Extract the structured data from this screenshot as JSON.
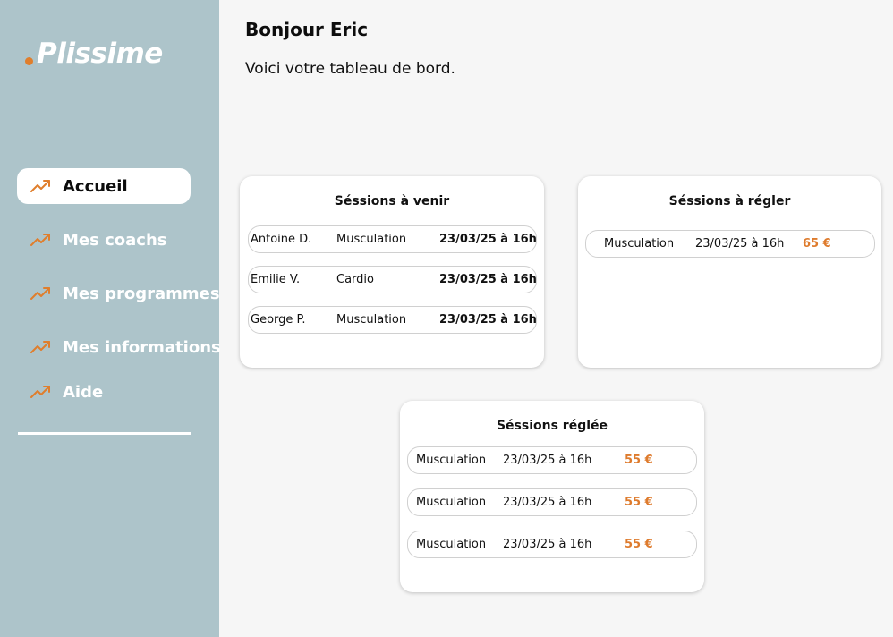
{
  "brand": {
    "name": "Plissime",
    "accent_color": "#e07e2c",
    "sidebar_color": "#adc4ca"
  },
  "sidebar": {
    "items": [
      {
        "label": "Accueil",
        "icon": "trending-up-icon",
        "active": true
      },
      {
        "label": "Mes coachs",
        "icon": "trending-up-icon",
        "active": false
      },
      {
        "label": "Mes programmes",
        "icon": "trending-up-icon",
        "active": false
      },
      {
        "label": "Mes informations",
        "icon": "trending-up-icon",
        "active": false
      },
      {
        "label": "Aide",
        "icon": "trending-up-icon",
        "active": false
      }
    ]
  },
  "header": {
    "greeting": "Bonjour Eric",
    "subtitle": "Voici votre tableau de bord."
  },
  "upcoming": {
    "title": "Séssions à venir",
    "rows": [
      {
        "coach": "Antoine D.",
        "activity": "Musculation",
        "date": "23/03/25 à 16h"
      },
      {
        "coach": "Emilie V.",
        "activity": "Cardio",
        "date": "23/03/25 à 16h"
      },
      {
        "coach": "George P.",
        "activity": "Musculation",
        "date": "23/03/25 à 16h"
      }
    ]
  },
  "to_pay": {
    "title": "Séssions à régler",
    "rows": [
      {
        "activity": "Musculation",
        "date": "23/03/25 à 16h",
        "price": "65 €"
      }
    ]
  },
  "paid": {
    "title": "Séssions réglée",
    "rows": [
      {
        "activity": "Musculation",
        "date": "23/03/25 à 16h",
        "price": "55 €"
      },
      {
        "activity": "Musculation",
        "date": "23/03/25 à 16h",
        "price": "55 €"
      },
      {
        "activity": "Musculation",
        "date": "23/03/25 à 16h",
        "price": "55 €"
      }
    ]
  }
}
